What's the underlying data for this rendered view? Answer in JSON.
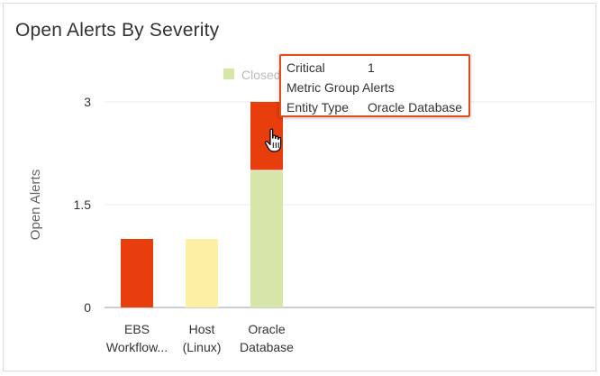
{
  "panel": {
    "title": "Open Alerts By Severity"
  },
  "chart_data": {
    "type": "bar",
    "stacked": true,
    "title": "Open Alerts By Severity",
    "ylabel": "Open Alerts",
    "xlabel": "",
    "ylim": [
      0,
      3
    ],
    "yticks": [
      "0",
      "1.5",
      "3"
    ],
    "yticks_values": [
      0,
      1.5,
      3
    ],
    "categories": [
      "EBS Workflow...",
      "Host (Linux)",
      "Oracle Database"
    ],
    "category_label_lines": [
      [
        "EBS",
        "Workflow..."
      ],
      [
        "Host",
        "(Linux)"
      ],
      [
        "Oracle",
        "Database"
      ]
    ],
    "series": [
      {
        "name": "Closed",
        "color": "#d6e6a8",
        "values": [
          0,
          0,
          2
        ]
      },
      {
        "name": "Critical",
        "color": "#e83d0c",
        "values": [
          1,
          0,
          1
        ]
      },
      {
        "color": "#fdf0a4",
        "values": [
          0,
          1,
          0
        ]
      }
    ],
    "legend": {
      "placement": "top",
      "visible_entries": [
        "Closed"
      ]
    },
    "grid": true
  },
  "tooltip": {
    "rows": [
      {
        "label": "Critical",
        "value": "1"
      },
      {
        "label": "Metric Group Alerts",
        "value": ""
      },
      {
        "label": "Entity Type",
        "value": "Oracle Database"
      }
    ],
    "border_color": "#e04e1e"
  },
  "cursor": {
    "icon": "hand-pointer-icon"
  }
}
